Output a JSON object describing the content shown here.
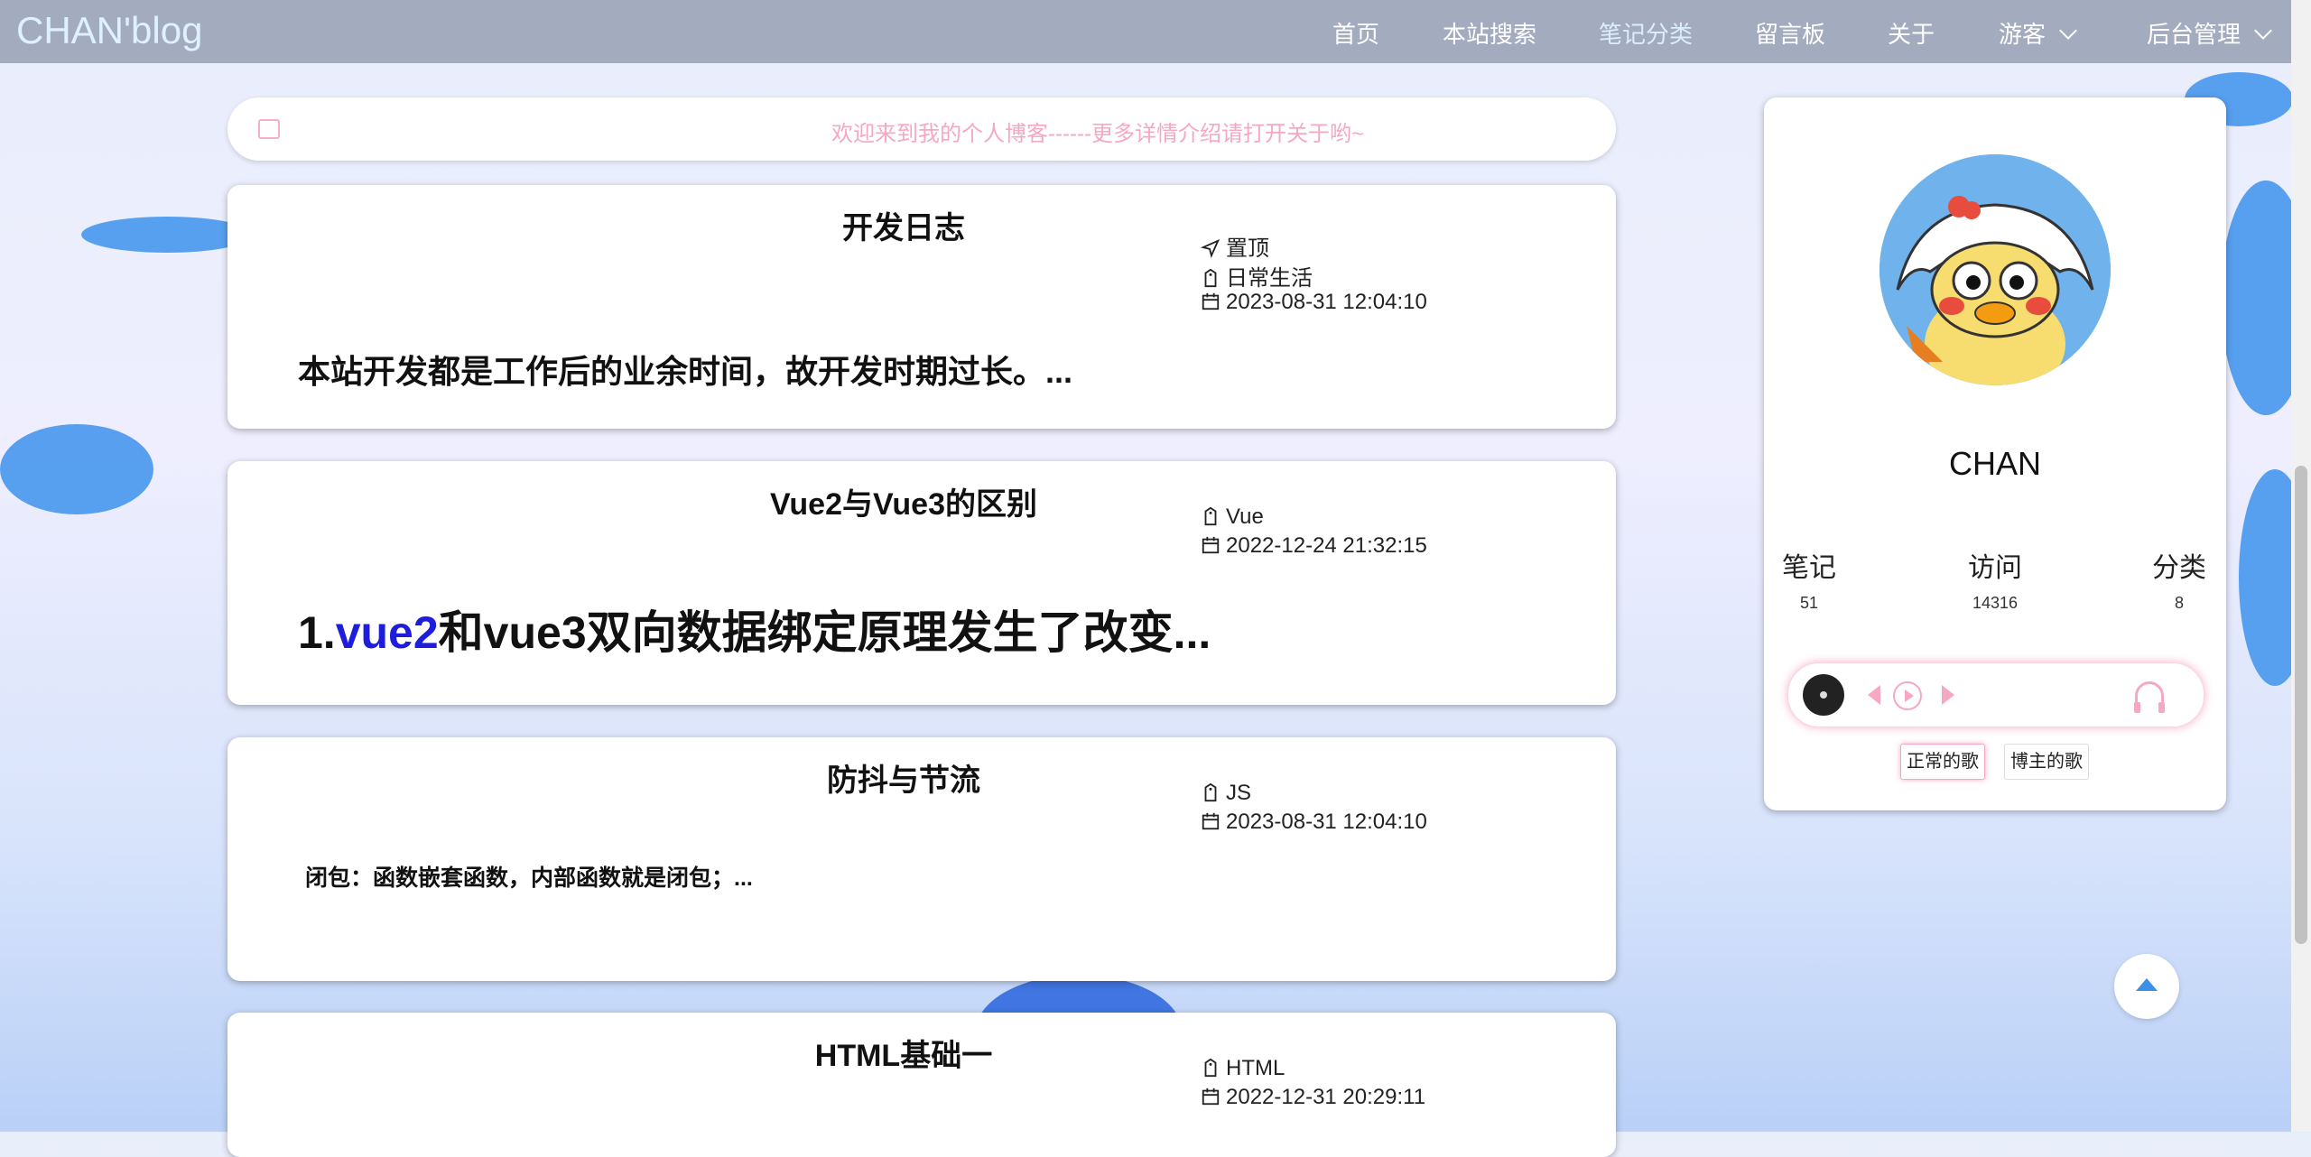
{
  "nav": {
    "brand": "CHAN'blog",
    "items": [
      {
        "label": "首页"
      },
      {
        "label": "本站搜索"
      },
      {
        "label": "笔记分类"
      },
      {
        "label": "留言板"
      },
      {
        "label": "关于"
      },
      {
        "label": "游客"
      },
      {
        "label": "后台管理"
      }
    ]
  },
  "notice": {
    "text": "欢迎来到我的个人博客------更多详情介绍请打开关于哟~"
  },
  "posts": [
    {
      "title": "开发日志",
      "pinned": "置顶",
      "category": "日常生活",
      "date": "2023-08-31 12:04:10",
      "excerpt": "本站开发都是工作后的业余时间，故开发时期过长。..."
    },
    {
      "title": "Vue2与Vue3的区别",
      "category": "Vue",
      "date": "2022-12-24 21:32:15",
      "excerpt_prefix": "1.",
      "excerpt_highlight": "vue2",
      "excerpt_rest": "和vue3双向数据绑定原理发生了改变..."
    },
    {
      "title": "防抖与节流",
      "category": "JS",
      "date": "2023-08-31 12:04:10",
      "excerpt": "闭包：函数嵌套函数，内部函数就是闭包；..."
    },
    {
      "title": "HTML基础一",
      "category": "HTML",
      "date": "2022-12-31 20:29:11"
    }
  ],
  "profile": {
    "name": "CHAN",
    "stats": [
      {
        "label": "笔记",
        "value": "51"
      },
      {
        "label": "访问",
        "value": "14316"
      },
      {
        "label": "分类",
        "value": "8"
      }
    ],
    "song_buttons": [
      "正常的歌",
      "博主的歌"
    ]
  },
  "colors": {
    "accent_pink": "#f6a8c1",
    "link_blue": "#1d1ddb",
    "brand_blue": "#4f9bee"
  }
}
